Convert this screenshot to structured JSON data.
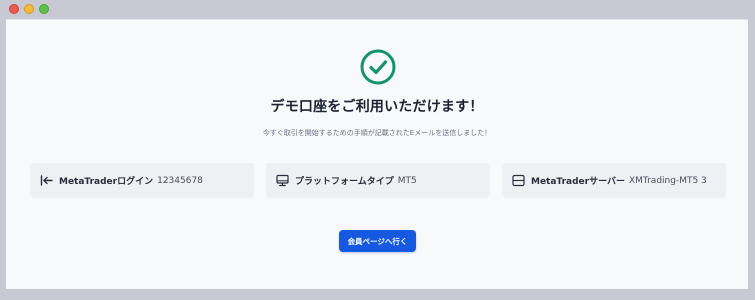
{
  "window": {
    "controls": [
      "close",
      "minimize",
      "maximize"
    ]
  },
  "colors": {
    "success": "#14936a",
    "primary": "#1559e0",
    "card_bg": "#eef0f3"
  },
  "status": {
    "icon": "check-circle-icon",
    "heading": "デモ口座をご利用いただけます！",
    "message": "今すぐ取引を開始するための手順が記載されたEメールを送信しました！"
  },
  "account_info": [
    {
      "icon": "login-arrow-icon",
      "label": "MetaTraderログイン",
      "value": "12345678"
    },
    {
      "icon": "monitor-icon",
      "label": "プラットフォームタイプ",
      "value": "MT5"
    },
    {
      "icon": "server-icon",
      "label": "MetaTraderサーバー",
      "value": "XMTrading-MT5 3"
    }
  ],
  "cta": {
    "label": "会員ページへ行く"
  }
}
